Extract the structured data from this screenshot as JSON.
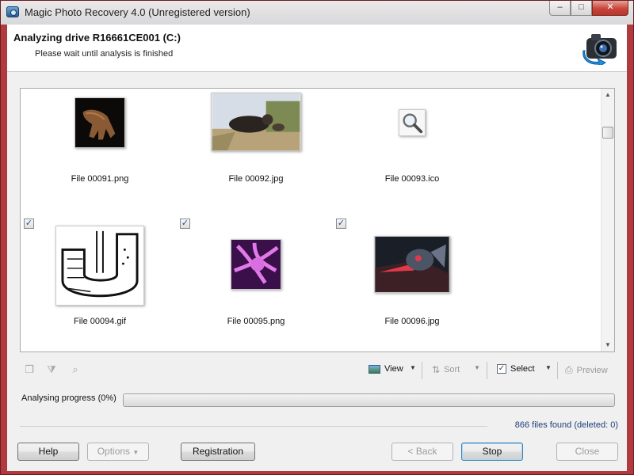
{
  "window": {
    "title": "Magic Photo Recovery 4.0 (Unregistered version)",
    "controls": {
      "minimize": "–",
      "maximize": "□",
      "close": "✕"
    }
  },
  "header": {
    "title": "Analyzing drive R16661CE001 (C:)",
    "subtitle": "Please wait until analysis is finished",
    "logo_icon": "camera-recovery-icon"
  },
  "files": [
    {
      "name": "File 00091.png",
      "checkbox_visible": false,
      "checked": false,
      "thumb": "hand-photo"
    },
    {
      "name": "File 00092.jpg",
      "checkbox_visible": false,
      "checked": false,
      "thumb": "animal-photo"
    },
    {
      "name": "File 00093.ico",
      "checkbox_visible": false,
      "checked": false,
      "thumb": "magnifier-icon"
    },
    {
      "name": "File 00094.gif",
      "checkbox_visible": true,
      "checked": true,
      "thumb": "letter-u-drawing"
    },
    {
      "name": "File 00095.png",
      "checkbox_visible": true,
      "checked": true,
      "thumb": "purple-fantasy"
    },
    {
      "name": "File 00096.jpg",
      "checkbox_visible": true,
      "checked": true,
      "thumb": "robot-artwork"
    }
  ],
  "toolbar": {
    "view_label": "View",
    "sort_label": "Sort",
    "select_label": "Select",
    "preview_label": "Preview",
    "icons": [
      "copy-icon",
      "filter-icon",
      "find-icon"
    ]
  },
  "progress": {
    "label": "Analysing progress (0%)",
    "value": 0
  },
  "status": {
    "found": "866 files found (deleted: 0)"
  },
  "buttons": {
    "help": "Help",
    "options": "Options",
    "registration": "Registration",
    "back": "< Back",
    "stop": "Stop",
    "close": "Close"
  },
  "colors": {
    "window_frame": "#b03a3e",
    "progress_fill": "#37b34a",
    "status_text": "#1c3f7a"
  }
}
